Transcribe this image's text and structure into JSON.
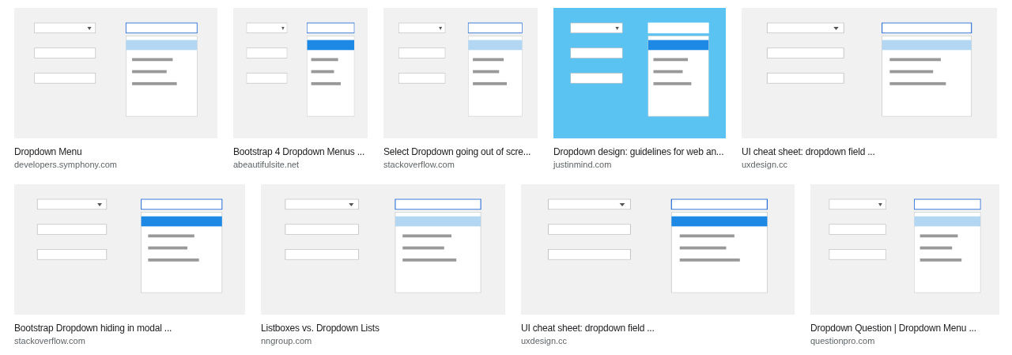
{
  "rows": [
    {
      "results": [
        {
          "kind": "picture",
          "title": "Dropdown Menu",
          "source": "developers.symphony.com"
        },
        {
          "kind": "picture",
          "title": "Bootstrap 4 Dropdown Menus ...",
          "source": "abeautifulsite.net"
        },
        {
          "kind": "picture",
          "title": "Select Dropdown going out of scre...",
          "source": "stackoverflow.com"
        },
        {
          "kind": "picture",
          "title": "Dropdown design: guidelines for web an...",
          "source": "justinmind.com"
        },
        {
          "kind": "picture",
          "title": "UI cheat sheet: dropdown field ...",
          "source": "uxdesign.cc"
        }
      ]
    },
    {
      "results": [
        {
          "kind": "picture",
          "title": "Bootstrap Dropdown hiding in modal ...",
          "source": "stackoverflow.com"
        },
        {
          "kind": "picture",
          "title": "Listboxes vs. Dropdown Lists",
          "source": "nngroup.com"
        },
        {
          "kind": "picture",
          "title": "UI cheat sheet: dropdown field ...",
          "source": "uxdesign.cc"
        },
        {
          "kind": "picture",
          "title": "Dropdown Question | Dropdown Menu ...",
          "source": "questionpro.com"
        }
      ]
    }
  ]
}
